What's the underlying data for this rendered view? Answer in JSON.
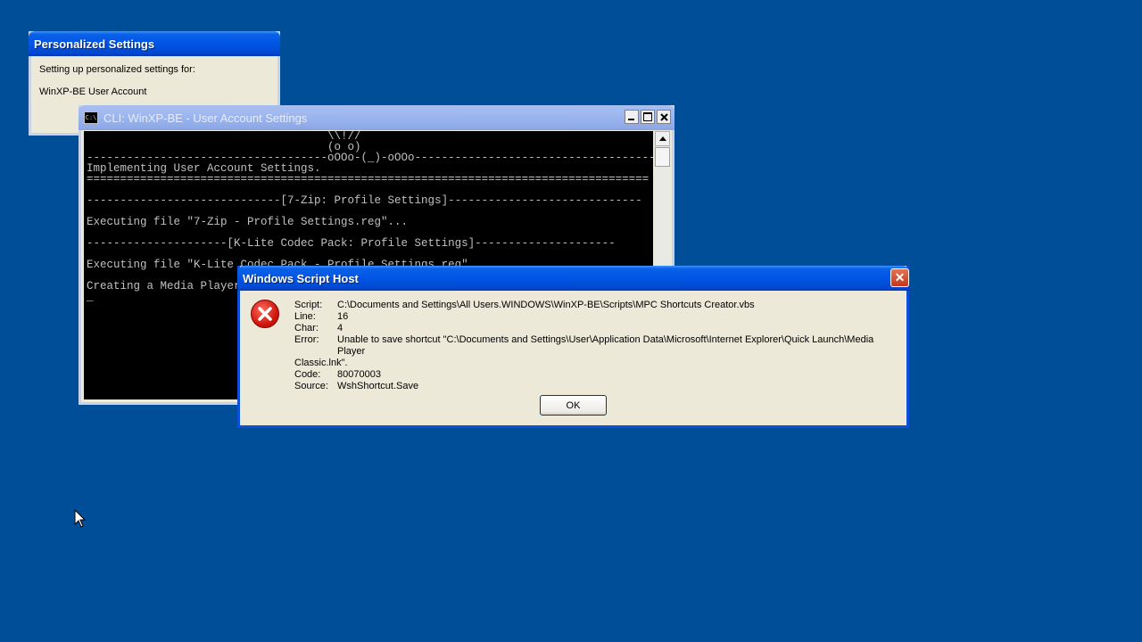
{
  "personalized": {
    "title": "Personalized Settings",
    "line1": "Setting up personalized settings for:",
    "line2": "WinXP-BE User Account"
  },
  "cli": {
    "title": "CLI: WinXP-BE - User Account Settings",
    "icon": "C:\\",
    "lines": [
      "                                    \\\\!//",
      "                                    (o o)",
      "------------------------------------oOOo-(_)-oOOo------------------------------------",
      "Implementing User Account Settings.",
      "====================================================================================",
      "",
      "-----------------------------[7-Zip: Profile Settings]-----------------------------",
      "",
      "Executing file \"7-Zip - Profile Settings.reg\"...",
      "",
      "---------------------[K-Lite Codec Pack: Profile Settings]---------------------",
      "",
      "Executing file \"K-Lite Codec Pack - Profile Settings.reg\"...",
      "",
      "Creating a Media Player Classic shortcut...",
      "_"
    ]
  },
  "wsh": {
    "title": "Windows Script Host",
    "close": "✕",
    "rows": [
      {
        "k": "Script:",
        "v": "C:\\Documents and Settings\\All Users.WINDOWS\\WinXP-BE\\Scripts\\MPC Shortcuts Creator.vbs"
      },
      {
        "k": "Line:",
        "v": "16"
      },
      {
        "k": "Char:",
        "v": "4"
      },
      {
        "k": "Error:",
        "v": "Unable to save shortcut \"C:\\Documents and Settings\\User\\Application Data\\Microsoft\\Internet Explorer\\Quick Launch\\Media Player"
      }
    ],
    "error_cont": "Classic.lnk\".",
    "rows2": [
      {
        "k": "Code:",
        "v": "80070003"
      },
      {
        "k": "Source:",
        "v": "WshShortcut.Save"
      }
    ],
    "ok": "OK"
  }
}
